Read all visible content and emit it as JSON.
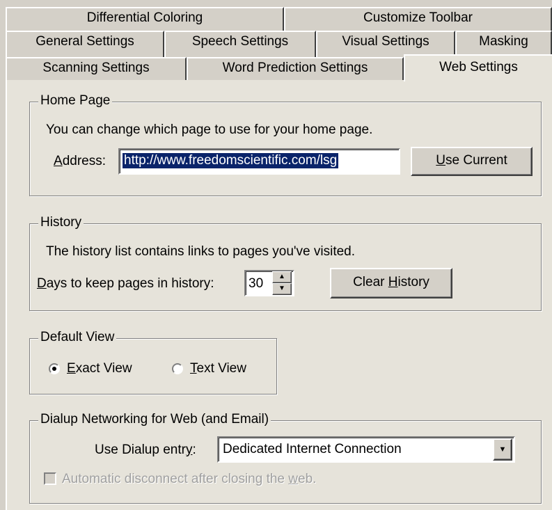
{
  "tabs": {
    "row1": [
      "Differential Coloring",
      "Customize Toolbar"
    ],
    "row2": [
      "General Settings",
      "Speech Settings",
      "Visual Settings",
      "Masking"
    ],
    "row3": [
      "Scanning Settings",
      "Word Prediction Settings",
      "Web Settings"
    ],
    "selected": "Web Settings"
  },
  "home_page": {
    "legend": "Home Page",
    "description": "You can change which page to use for your home page.",
    "address_label_pre": "",
    "address_label_u": "A",
    "address_label_post": "ddress:",
    "address_value": "http://www.freedomscientific.com/lsg",
    "use_current_u": "U",
    "use_current_post": "se Current"
  },
  "history": {
    "legend": "History",
    "description": "The history list contains links to pages you've visited.",
    "days_label_u": "D",
    "days_label_post": "ays to keep pages in history:",
    "days_value": "30",
    "clear_pre": "Clear ",
    "clear_u": "H",
    "clear_post": "istory"
  },
  "default_view": {
    "legend": "Default View",
    "exact_u": "E",
    "exact_post": "xact View",
    "text_u": "T",
    "text_post": "ext View",
    "selected": "Exact View"
  },
  "dialup": {
    "legend": "Dialup Networking for Web (and Email)",
    "entry_label_pre": "Use Dialup entr",
    "entry_label_u": "y",
    "entry_label_post": ":",
    "entry_value": "Dedicated Internet Connection",
    "auto_pre": "Automatic disconnect after closing the ",
    "auto_u": "w",
    "auto_post": "eb.",
    "auto_checked": false,
    "auto_disabled": true
  },
  "colors": {
    "face": "#d4d0c8",
    "selection": "#0a246a",
    "disabled_text": "#a0a0a0"
  }
}
